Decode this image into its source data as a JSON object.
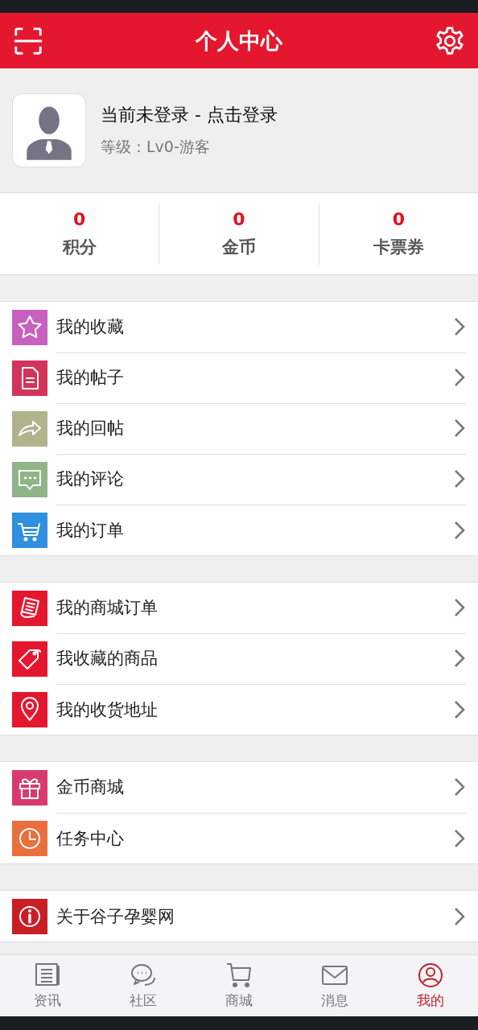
{
  "header": {
    "title": "个人中心"
  },
  "profile": {
    "name": "当前未登录 - 点击登录",
    "level": "等级：Lv0-游客"
  },
  "stats": [
    {
      "value": "0",
      "label": "积分"
    },
    {
      "value": "0",
      "label": "金币"
    },
    {
      "value": "0",
      "label": "卡票券"
    }
  ],
  "menu_groups": [
    [
      {
        "label": "我的收藏",
        "kind": "star",
        "color": "#c860c0"
      },
      {
        "label": "我的帖子",
        "kind": "document",
        "color": "#d3345a"
      },
      {
        "label": "我的回帖",
        "kind": "share",
        "color": "#b0b48c"
      },
      {
        "label": "我的评论",
        "kind": "chat",
        "color": "#8fb488"
      },
      {
        "label": "我的订单",
        "kind": "cart",
        "color": "#2f8fe0"
      }
    ],
    [
      {
        "label": "我的商城订单",
        "kind": "receipt",
        "color": "#e5172f"
      },
      {
        "label": "我收藏的商品",
        "kind": "tag",
        "color": "#e5172f"
      },
      {
        "label": "我的收货地址",
        "kind": "pin",
        "color": "#e5172f"
      }
    ],
    [
      {
        "label": "金币商城",
        "kind": "gift",
        "color": "#d83a70"
      },
      {
        "label": "任务中心",
        "kind": "clock",
        "color": "#e9703c"
      }
    ],
    [
      {
        "label": "关于谷子孕婴网",
        "kind": "info",
        "color": "#c81e24"
      }
    ]
  ],
  "tab_bar": [
    {
      "label": "资讯",
      "kind": "news",
      "selected": false
    },
    {
      "label": "社区",
      "kind": "chat",
      "selected": false
    },
    {
      "label": "商城",
      "kind": "cart",
      "selected": false
    },
    {
      "label": "消息",
      "kind": "mail",
      "selected": false
    },
    {
      "label": "我的",
      "kind": "user",
      "selected": true
    }
  ]
}
